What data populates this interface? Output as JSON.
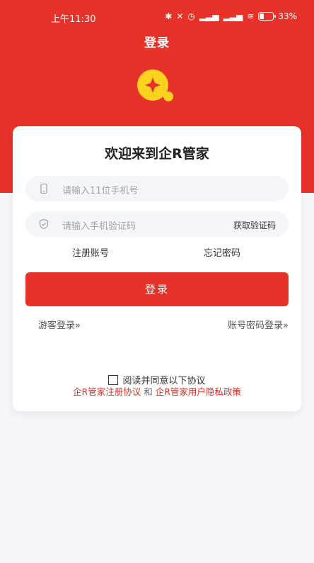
{
  "status": {
    "time": "上午11:30",
    "battery": "33%"
  },
  "header": {
    "title": "登录"
  },
  "login": {
    "welcome": "欢迎来到企R管家",
    "phone_placeholder": "请输入11位手机号",
    "code_placeholder": "请输入手机验证码",
    "get_code": "获取验证码",
    "register": "注册账号",
    "forgot": "忘记密码",
    "login_button": "登录",
    "guest_login": "游客登录»",
    "password_login": "账号密码登录»"
  },
  "agreement": {
    "text": "阅读并同意以下协议",
    "register_policy": "企R管家注册协议",
    "and": "和",
    "privacy_policy": "企R管家用户隐私政策"
  },
  "colors": {
    "brand": "#e63229",
    "logo": "#ffd21f",
    "background": "#f5f6f9"
  }
}
